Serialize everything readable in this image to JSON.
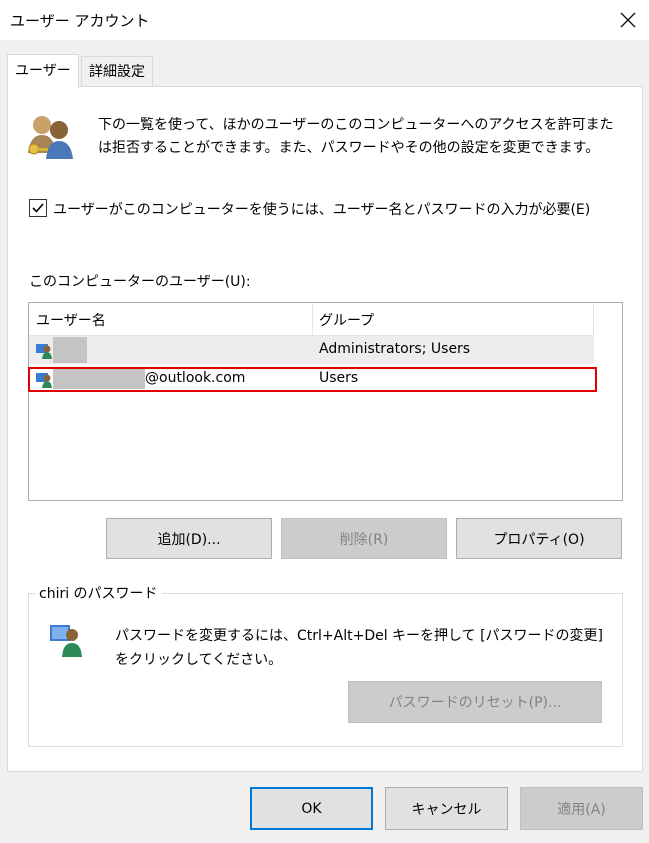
{
  "window": {
    "title": "ユーザー アカウント",
    "close_icon": "close-icon"
  },
  "tabs": [
    {
      "label": "ユーザー",
      "active": true
    },
    {
      "label": "詳細設定",
      "active": false
    }
  ],
  "users_tab": {
    "description": "下の一覧を使って、ほかのユーザーのこのコンピューターへのアクセスを許可または拒否することができます。また、パスワードやその他の設定を変更できます。",
    "require_login_checkbox": {
      "label": "ユーザーがこのコンピューターを使うには、ユーザー名とパスワードの入力が必要(E)",
      "checked": true
    },
    "users_list_label": "このコンピューターのユーザー(U):",
    "columns": [
      "ユーザー名",
      "グループ"
    ],
    "rows": [
      {
        "name": "",
        "group": "Administrators; Users",
        "selected": true,
        "name_redacted": true
      },
      {
        "name": "@outlook.com",
        "group": "Users",
        "selected": false,
        "name_redacted": true,
        "highlighted": true
      }
    ],
    "buttons": {
      "add": "追加(D)...",
      "remove": "削除(R)",
      "properties": "プロパティ(O)"
    },
    "password_group": {
      "title": "chiri のパスワード",
      "description": "パスワードを変更するには、Ctrl+Alt+Del キーを押して [パスワードの変更] をクリックしてください。",
      "reset_button": "パスワードのリセット(P)..."
    }
  },
  "dialog_buttons": {
    "ok": "OK",
    "cancel": "キャンセル",
    "apply": "適用(A)"
  },
  "colors": {
    "highlight_border": "#e00000",
    "default_button_border": "#0078d7",
    "selected_row": "#ededed"
  }
}
